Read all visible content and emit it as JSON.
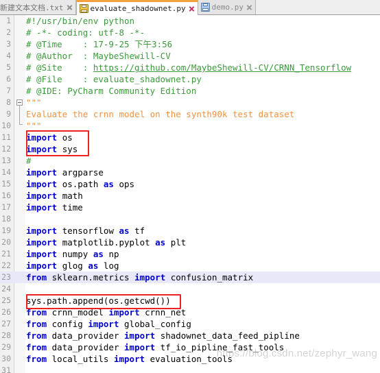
{
  "window": {
    "app": "PyCharm Community Edition",
    "watermark": "https://blog.csdn.net/zephyr_wang"
  },
  "colors": {
    "accent_active_tab": "#f3a13c",
    "comment_green": "#3b9a3b",
    "docstring_orange": "#ef9243",
    "keyword_blue": "#0000cf",
    "annotation_red": "#ef2020",
    "caret_line": "#e8e8f8",
    "gutter_bg": "#f0f0f0",
    "tabbar_bg": "#efefef"
  },
  "tabs": [
    {
      "label": "新建文本文档.txt",
      "active": false,
      "icon": "text-file-icon",
      "close": "close-icon"
    },
    {
      "label": "evaluate_shadownet.py",
      "active": true,
      "icon": "python-file-icon",
      "close": "close-icon"
    },
    {
      "label": "demo.py",
      "active": false,
      "icon": "python-file-icon",
      "close": "close-icon"
    }
  ],
  "editor": {
    "highlighted_line": 23,
    "lines": [
      {
        "n": 1,
        "text": "#!/usr/bin/env python"
      },
      {
        "n": 2,
        "text": "# -*- coding: utf-8 -*-"
      },
      {
        "n": 3,
        "text": "# @Time    : 17-9-25 下午3:56"
      },
      {
        "n": 4,
        "text": "# @Author  : MaybeShewill-CV"
      },
      {
        "n": 5,
        "text": "# @Site    : https://github.com/MaybeShewill-CV/CRNN_Tensorflow"
      },
      {
        "n": 6,
        "text": "# @File    : evaluate_shadownet.py"
      },
      {
        "n": 7,
        "text": "# @IDE: PyCharm Community Edition"
      },
      {
        "n": 8,
        "text": "\"\"\""
      },
      {
        "n": 9,
        "text": "Evaluate the crnn model on the synth90k test dataset"
      },
      {
        "n": 10,
        "text": "\"\"\""
      },
      {
        "n": 11,
        "text": "import os"
      },
      {
        "n": 12,
        "text": "import sys"
      },
      {
        "n": 13,
        "text": "#"
      },
      {
        "n": 14,
        "text": "import argparse"
      },
      {
        "n": 15,
        "text": "import os.path as ops"
      },
      {
        "n": 16,
        "text": "import math"
      },
      {
        "n": 17,
        "text": "import time"
      },
      {
        "n": 18,
        "text": ""
      },
      {
        "n": 19,
        "text": "import tensorflow as tf"
      },
      {
        "n": 20,
        "text": "import matplotlib.pyplot as plt"
      },
      {
        "n": 21,
        "text": "import numpy as np"
      },
      {
        "n": 22,
        "text": "import glog as log"
      },
      {
        "n": 23,
        "text": "from sklearn.metrics import confusion_matrix"
      },
      {
        "n": 24,
        "text": ""
      },
      {
        "n": 25,
        "text": "sys.path.append(os.getcwd())"
      },
      {
        "n": 26,
        "text": "from crnn_model import crnn_net"
      },
      {
        "n": 27,
        "text": "from config import global_config"
      },
      {
        "n": 28,
        "text": "from data_provider import shadownet_data_feed_pipline"
      },
      {
        "n": 29,
        "text": "from data_provider import tf_io_pipline_fast_tools"
      },
      {
        "n": 30,
        "text": "from local_utils import evaluation_tools"
      },
      {
        "n": 31,
        "text": ""
      }
    ]
  },
  "annotations": [
    {
      "name": "redbox-imports-os-sys",
      "lines": "11-12"
    },
    {
      "name": "redbox-syspath-append",
      "lines": "25"
    }
  ]
}
